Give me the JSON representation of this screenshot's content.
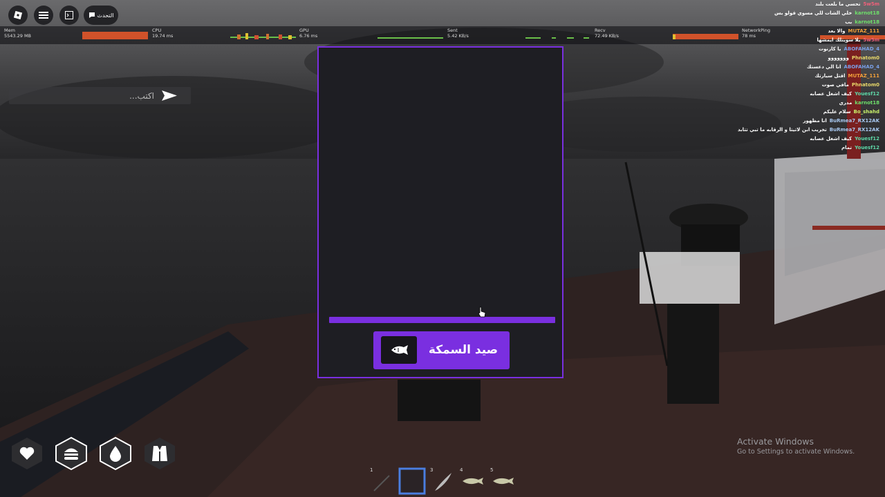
{
  "topbar": {
    "roblox_icon": "roblox-logo-icon",
    "menu_icon": "hamburger-icon",
    "chat_toggle_icon": "chat-icon",
    "chat_label": "التحدث"
  },
  "stats": {
    "mem": {
      "label": "Mem",
      "value": "5543.29 MB"
    },
    "cpu": {
      "label": "CPU",
      "value": "19.74 ms"
    },
    "gpu": {
      "label": "GPU",
      "value": "6.76 ms"
    },
    "sent": {
      "label": "Sent",
      "value": "5.42 KB/s"
    },
    "recv": {
      "label": "Recv",
      "value": "72.49 KB/s"
    },
    "ping": {
      "label": "NetworkPing",
      "value": "78 ms"
    }
  },
  "chat": {
    "input_placeholder": "اكتب...",
    "send_icon": "send-icon",
    "lines": [
      {
        "user": "5w5m",
        "msg": "تحسي ما بلعت بلند",
        "color": "#f0607a"
      },
      {
        "user": "karnot18",
        "msg": "خلي الشات للي مسوي قولو بس",
        "color": "#6ee06a"
      },
      {
        "user": "karnot18",
        "msg": "بب",
        "color": "#6ee06a"
      },
      {
        "user": "MUTAZ_111",
        "msg": "والا بعد",
        "color": "#f2a03a"
      },
      {
        "user": "5w5m",
        "msg": "يلا سويتلك ايمشها",
        "color": "#f0607a"
      },
      {
        "user": "ABOFAHAD_4",
        "msg": "يا كارنوت",
        "color": "#7aa0e8"
      },
      {
        "user": "Phnatom0",
        "msg": "ووووووو",
        "color": "#e8d86a"
      },
      {
        "user": "ABOFAHAD_4",
        "msg": "انا الي دعستك",
        "color": "#7aa0e8"
      },
      {
        "user": "MUTAZ_111",
        "msg": "اقتل سيارتك",
        "color": "#f2a03a"
      },
      {
        "user": "Phnatom0",
        "msg": "مافي صوت",
        "color": "#e8d86a"
      },
      {
        "user": "Youesf12",
        "msg": "كيف اشغل عصابه",
        "color": "#5ed8a8"
      },
      {
        "user": "karnot18",
        "msg": "مدري",
        "color": "#6ee06a"
      },
      {
        "user": "Bo_shahd",
        "msg": "سلام عليكم",
        "color": "#c8f06a"
      },
      {
        "user": "BuRmea7_RX12AK",
        "msg": "انا مظهور",
        "color": "#a8c8f0"
      },
      {
        "user": "BuRmea7_RX12AK",
        "msg": "تخريب ابن لاتيتا و الرقابه ما تبي تتابد",
        "color": "#a8c8f0"
      },
      {
        "user": "Youesf12",
        "msg": "كيف اشغل عصابه",
        "color": "#5ed8a8"
      },
      {
        "user": "Youesf12",
        "msg": "تمام",
        "color": "#5ed8a8"
      }
    ]
  },
  "fishing": {
    "catch_label": "صيد السمكة",
    "fish_icon": "fish-icon",
    "progress": 1.0,
    "accent": "#7a2fe0"
  },
  "status_icons": [
    "heart-icon",
    "burger-icon",
    "water-drop-icon",
    "vest-icon"
  ],
  "hotbar": {
    "slots": [
      {
        "number": "1",
        "item": "fishing-rod-icon"
      },
      {
        "number": "",
        "item": "empty-slot",
        "selected": true
      },
      {
        "number": "3",
        "item": "feather-icon"
      },
      {
        "number": "4",
        "item": "fish-item-icon"
      },
      {
        "number": "5",
        "item": "fish-item-icon"
      }
    ]
  },
  "watermark": {
    "title": "Activate Windows",
    "subtitle": "Go to Settings to activate Windows."
  }
}
